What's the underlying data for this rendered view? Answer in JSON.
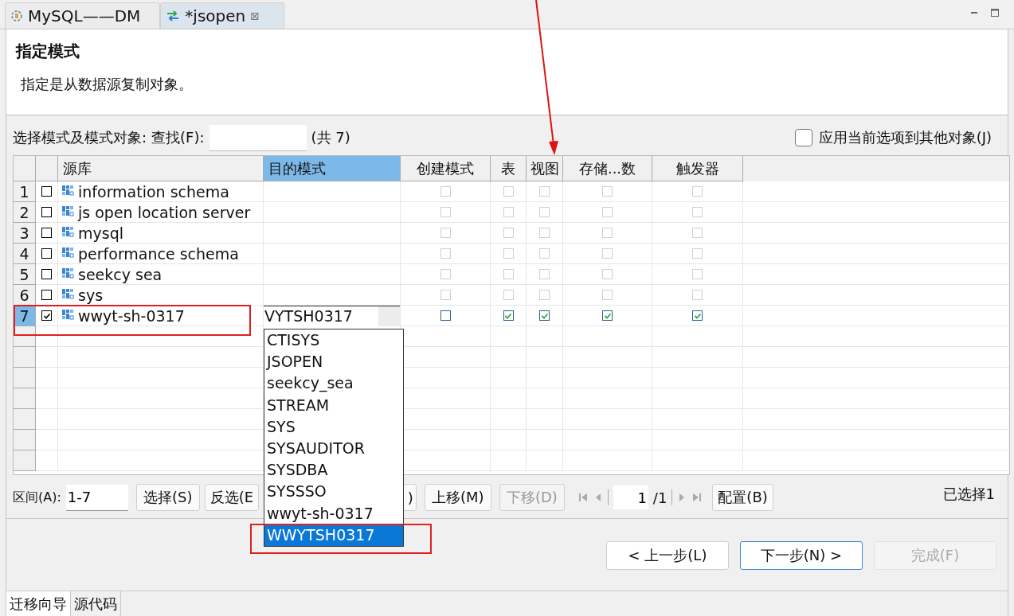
{
  "editor_tabs": [
    {
      "label": "MySQL——DM",
      "selected": false,
      "closable": false
    },
    {
      "label": "*jsopen",
      "selected": true,
      "closable": true
    }
  ],
  "close_glyph": "⊠",
  "page": {
    "title": "指定模式",
    "description": "指定是从数据源复制对象。"
  },
  "filter": {
    "label": "选择模式及模式对象:",
    "search_label": "查找(F):",
    "count": "(共 7)",
    "apply_label": "应用当前选项到其他对象(J)",
    "apply_checked": false
  },
  "table": {
    "columns": [
      {
        "label": "源库",
        "selected": false
      },
      {
        "label": "目的模式",
        "selected": true
      },
      {
        "label": "创建模式",
        "selected": false
      },
      {
        "label": "表",
        "selected": false
      },
      {
        "label": "视图",
        "selected": false
      },
      {
        "label": "存储...数",
        "selected": false
      },
      {
        "label": "触发器",
        "selected": false
      }
    ],
    "rows": [
      {
        "number": "1",
        "selected": false,
        "checked": false,
        "source": "information schema",
        "target": "",
        "options": [
          {
            "checked": false,
            "disabled": true
          },
          {
            "checked": false,
            "disabled": true
          },
          {
            "checked": false,
            "disabled": true
          },
          {
            "checked": false,
            "disabled": true
          },
          {
            "checked": false,
            "disabled": true
          }
        ]
      },
      {
        "number": "2",
        "selected": false,
        "checked": false,
        "source": "js open location server",
        "target": "",
        "options": [
          {
            "checked": false,
            "disabled": true
          },
          {
            "checked": false,
            "disabled": true
          },
          {
            "checked": false,
            "disabled": true
          },
          {
            "checked": false,
            "disabled": true
          },
          {
            "checked": false,
            "disabled": true
          }
        ]
      },
      {
        "number": "3",
        "selected": false,
        "checked": false,
        "source": "mysql",
        "target": "",
        "options": [
          {
            "checked": false,
            "disabled": true
          },
          {
            "checked": false,
            "disabled": true
          },
          {
            "checked": false,
            "disabled": true
          },
          {
            "checked": false,
            "disabled": true
          },
          {
            "checked": false,
            "disabled": true
          }
        ]
      },
      {
        "number": "4",
        "selected": false,
        "checked": false,
        "source": "performance schema",
        "target": "",
        "options": [
          {
            "checked": false,
            "disabled": true
          },
          {
            "checked": false,
            "disabled": true
          },
          {
            "checked": false,
            "disabled": true
          },
          {
            "checked": false,
            "disabled": true
          },
          {
            "checked": false,
            "disabled": true
          }
        ]
      },
      {
        "number": "5",
        "selected": false,
        "checked": false,
        "source": "seekcy sea",
        "target": "",
        "options": [
          {
            "checked": false,
            "disabled": true
          },
          {
            "checked": false,
            "disabled": true
          },
          {
            "checked": false,
            "disabled": true
          },
          {
            "checked": false,
            "disabled": true
          },
          {
            "checked": false,
            "disabled": true
          }
        ]
      },
      {
        "number": "6",
        "selected": false,
        "checked": false,
        "source": "sys",
        "target": "",
        "options": [
          {
            "checked": false,
            "disabled": true
          },
          {
            "checked": false,
            "disabled": true
          },
          {
            "checked": false,
            "disabled": true
          },
          {
            "checked": false,
            "disabled": true
          },
          {
            "checked": false,
            "disabled": true
          }
        ]
      },
      {
        "number": "7",
        "selected": true,
        "checked": true,
        "source": "wwyt-sh-0317",
        "target": "VYTSH0317",
        "options": [
          {
            "checked": false,
            "disabled": false
          },
          {
            "checked": true,
            "disabled": false
          },
          {
            "checked": true,
            "disabled": false
          },
          {
            "checked": true,
            "disabled": false
          },
          {
            "checked": true,
            "disabled": false
          }
        ]
      }
    ]
  },
  "dropdown": [
    {
      "label": "CTISYS",
      "selected": false
    },
    {
      "label": "JSOPEN",
      "selected": false
    },
    {
      "label": "seekcy_sea",
      "selected": false
    },
    {
      "label": "STREAM",
      "selected": false
    },
    {
      "label": "SYS",
      "selected": false
    },
    {
      "label": "SYSAUDITOR",
      "selected": false
    },
    {
      "label": "SYSDBA",
      "selected": false
    },
    {
      "label": "SYSSSO",
      "selected": false
    },
    {
      "label": "wwyt-sh-0317",
      "selected": false
    },
    {
      "label": "WWYTSH0317",
      "selected": true
    }
  ],
  "toolbar": {
    "range_label": "区间(A):",
    "range_value": "1-7",
    "buttons": [
      {
        "label": "选择(S)",
        "disabled": false
      },
      {
        "label": "反选(E",
        "disabled": false
      },
      {
        "label": ")",
        "disabled": false
      },
      {
        "label": "上移(M)",
        "disabled": false
      },
      {
        "label": "下移(D)",
        "disabled": true
      }
    ],
    "page_value": "1",
    "page_total": "/1",
    "config": "配置(B)",
    "selected_count": "已选择1"
  },
  "wizard_buttons": [
    {
      "label": "< 上一步(L)",
      "disabled": false,
      "default": false
    },
    {
      "label": "下一步(N) >",
      "disabled": false,
      "default": true
    },
    {
      "label": "完成(F)",
      "disabled": true,
      "default": false
    }
  ],
  "bottom_tabs": [
    {
      "label": "迁移向导",
      "selected": true
    },
    {
      "label": "源代码",
      "selected": false
    }
  ]
}
